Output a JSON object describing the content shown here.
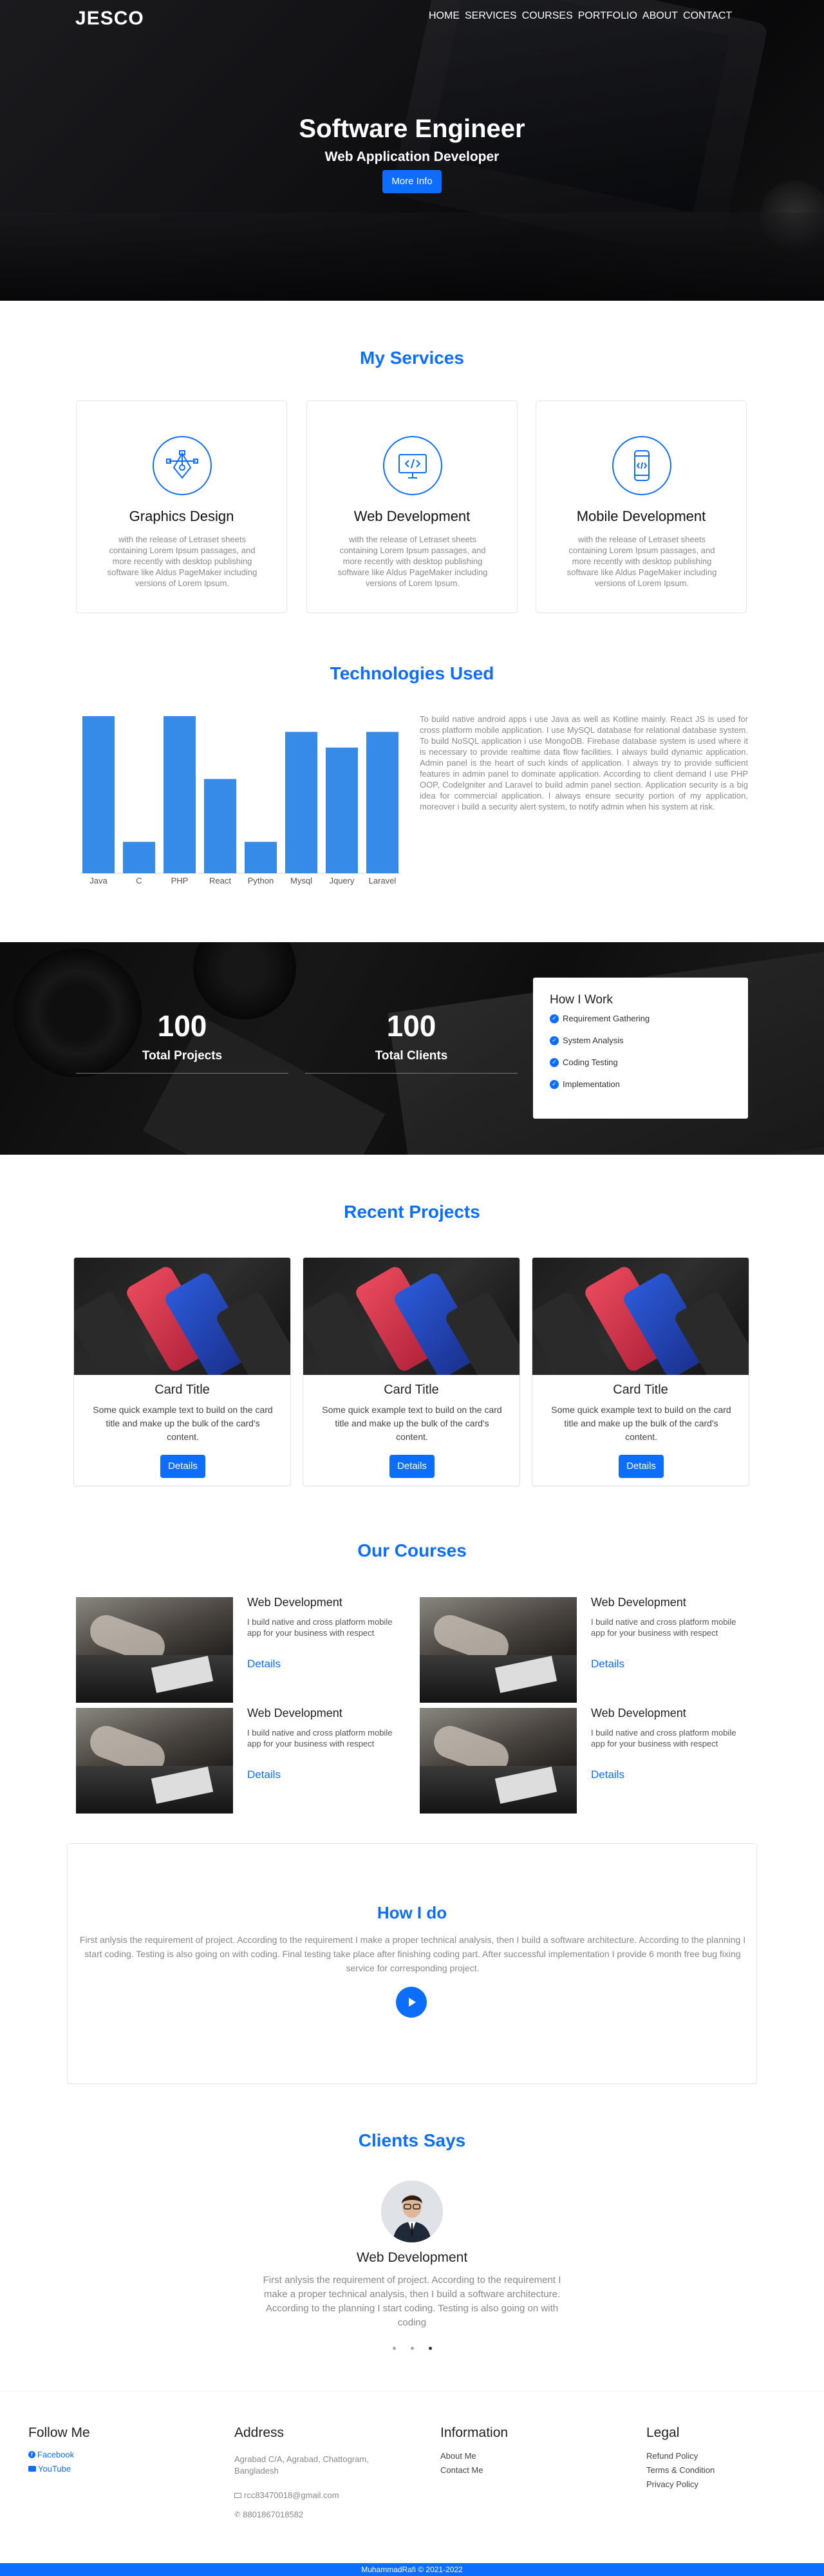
{
  "brand": "JESCO",
  "nav": [
    "HOME",
    "SERVICES",
    "COURSES",
    "PORTFOLIO",
    "ABOUT",
    "CONTACT"
  ],
  "hero": {
    "title": "Software Engineer",
    "subtitle": "Web Application Developer",
    "button": "More Info"
  },
  "services": {
    "title": "My Services",
    "items": [
      {
        "icon": "pen-tool-icon",
        "title": "Graphics Design",
        "desc": "with the release of Letraset sheets containing Lorem Ipsum passages, and more recently with desktop publishing software like Aldus PageMaker including versions of Lorem Ipsum."
      },
      {
        "icon": "code-monitor-icon",
        "title": "Web Development",
        "desc": "with the release of Letraset sheets containing Lorem Ipsum passages, and more recently with desktop publishing software like Aldus PageMaker including versions of Lorem Ipsum."
      },
      {
        "icon": "mobile-code-icon",
        "title": "Mobile Development",
        "desc": "with the release of Letraset sheets containing Lorem Ipsum passages, and more recently with desktop publishing software like Aldus PageMaker including versions of Lorem Ipsum."
      }
    ]
  },
  "tech": {
    "title": "Technologies Used",
    "text": "To build native android apps i use Java as well as Kotline mainly. React JS is used for cross platform mobile application. I use MySQL database for relational database system. To build NoSQL application i use MongoDB. Firebase database system is used where it is necessary to provide realtime data flow facilities. I always build dynamic application. Admin panel is the heart of such kinds of application. I always try to provide sufficient features in admin panel to dominate application. According to client demand I use PHP OOP, CodeIgniter and Laravel to build admin panel section. Application security is a big idea for commercial application. I always ensure security portion of my application, moreover i build a security alert system, to notify admin when his system at risk."
  },
  "chart_data": {
    "type": "bar",
    "categories": [
      "Java",
      "C",
      "PHP",
      "React",
      "Python",
      "Mysql",
      "Jquery",
      "Laravel"
    ],
    "values": [
      100,
      20,
      100,
      60,
      20,
      90,
      80,
      90
    ],
    "title": "",
    "xlabel": "",
    "ylabel": "",
    "ylim": [
      0,
      100
    ],
    "color": "#368be8"
  },
  "stats": {
    "projects": {
      "num": "100",
      "label": "Total Projects"
    },
    "clients": {
      "num": "100",
      "label": "Total Clients"
    },
    "how": {
      "title": "How I Work",
      "items": [
        "Requirement Gathering",
        "System Analysis",
        "Coding Testing",
        "Implementation"
      ]
    }
  },
  "projects": {
    "title": "Recent Projects",
    "items": [
      {
        "title": "Card Title",
        "text": "Some quick example text to build on the card title and make up the bulk of the card's content.",
        "button": "Details"
      },
      {
        "title": "Card Title",
        "text": "Some quick example text to build on the card title and make up the bulk of the card's content.",
        "button": "Details"
      },
      {
        "title": "Card Title",
        "text": "Some quick example text to build on the card title and make up the bulk of the card's content.",
        "button": "Details"
      }
    ]
  },
  "courses": {
    "title": "Our Courses",
    "items": [
      {
        "title": "Web Development",
        "desc": "I build native and cross platform mobile app for your business with respect",
        "link": "Details"
      },
      {
        "title": "Web Development",
        "desc": "I build native and cross platform mobile app for your business with respect",
        "link": "Details"
      },
      {
        "title": "Web Development",
        "desc": "I build native and cross platform mobile app for your business with respect",
        "link": "Details"
      },
      {
        "title": "Web Development",
        "desc": "I build native and cross platform mobile app for your business with respect",
        "link": "Details"
      }
    ]
  },
  "howdo": {
    "title": "How I do",
    "text": "First anlysis the requirement of project. According to the requirement I make a proper technical analysis, then I build a software architecture. According to the planning I start coding. Testing is also going on with coding. Final testing take place after finishing coding part. After successful implementation I provide 6 month free bug fixing service for corresponding project."
  },
  "clients": {
    "title": "Clients Says",
    "name": "Web Development",
    "text": "First anlysis the requirement of project. According to the requirement I make a proper technical analysis, then I build a software architecture. According to the planning I start coding. Testing is also going on with coding"
  },
  "footer": {
    "follow": {
      "title": "Follow Me",
      "links": [
        "Facebook",
        "YouTube"
      ]
    },
    "address": {
      "title": "Address",
      "lines": "Agrabad C/A, Agrabad, Chattogram, Bangladesh",
      "email": "rcc83470018@gmail.com",
      "phone": "8801867018582"
    },
    "info": {
      "title": "Information",
      "links": [
        "About Me",
        "Contact Me"
      ]
    },
    "legal": {
      "title": "Legal",
      "links": [
        "Refund Policy",
        "Terms & Condition",
        "Privacy Policy"
      ]
    },
    "copyright": "MuhammadRafi © 2021-2022"
  }
}
